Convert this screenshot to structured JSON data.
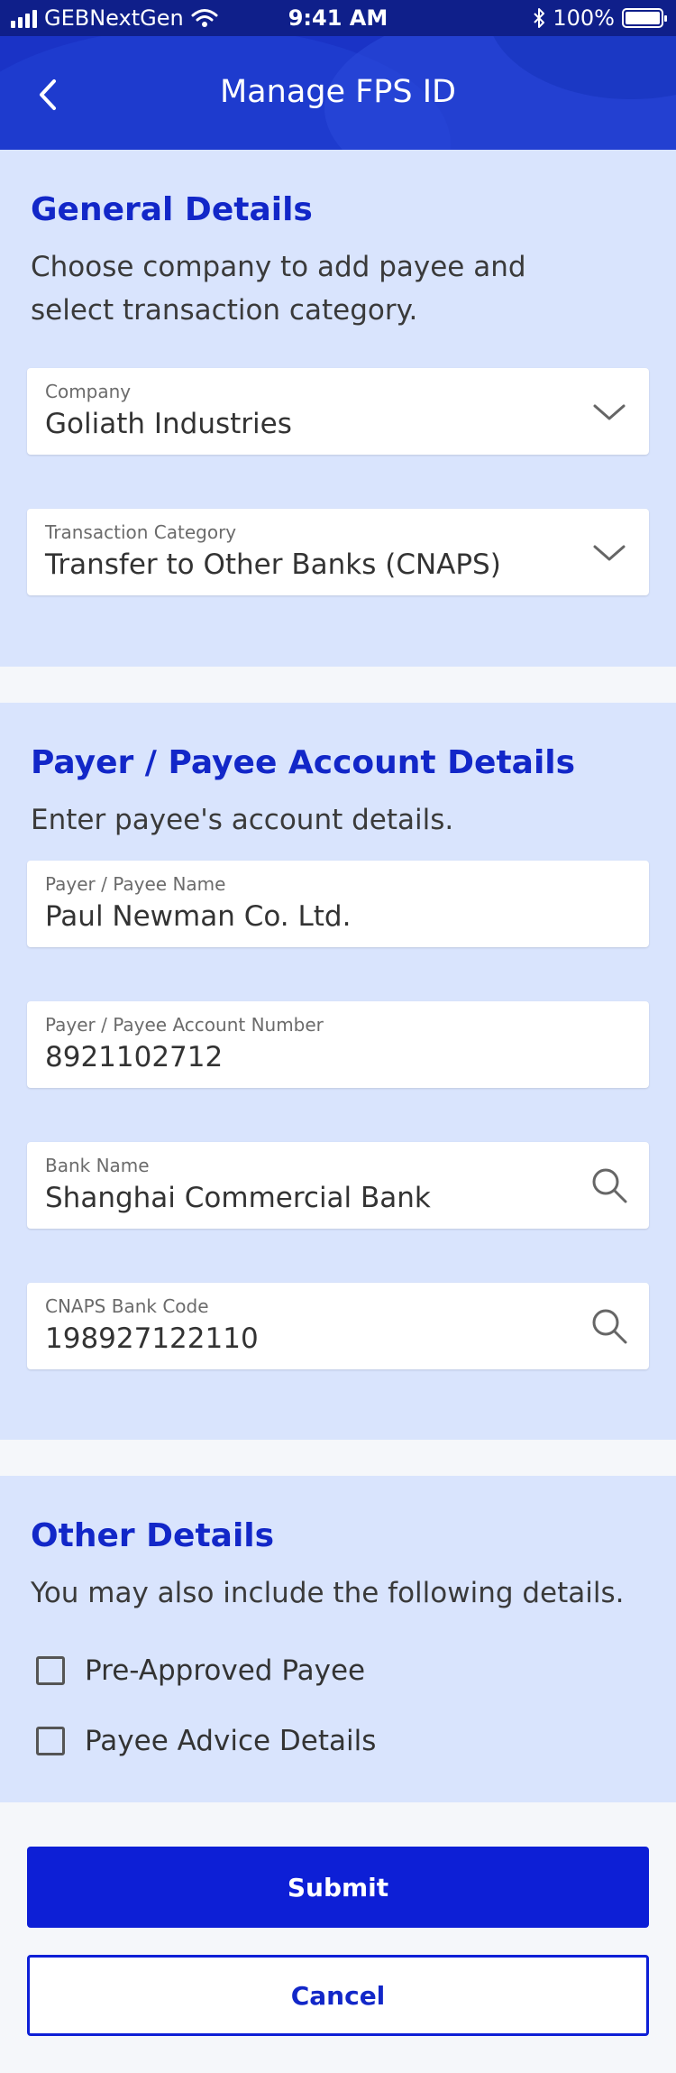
{
  "status_bar": {
    "carrier": "GEBNextGen",
    "time": "9:41 AM",
    "battery": "100%"
  },
  "header": {
    "title": "Manage FPS ID",
    "back_icon": "chevron-left-icon"
  },
  "general": {
    "title": "General Details",
    "description": "Choose company to add payee and select transaction category.",
    "company": {
      "label": "Company",
      "value": "Goliath Industries",
      "icon": "chevron-down-icon"
    },
    "transaction_category": {
      "label": "Transaction Category",
      "value": "Transfer to Other Banks (CNAPS)",
      "icon": "chevron-down-icon"
    }
  },
  "payee": {
    "title": "Payer / Payee Account Details",
    "description": "Enter payee's account details.",
    "name": {
      "label": "Payer / Payee Name",
      "value": "Paul Newman Co. Ltd."
    },
    "account_number": {
      "label": "Payer / Payee Account Number",
      "value": "8921102712"
    },
    "bank_name": {
      "label": "Bank Name",
      "value": "Shanghai Commercial Bank",
      "icon": "search-icon"
    },
    "cnaps_code": {
      "label": "CNAPS Bank Code",
      "value": "198927122110",
      "icon": "search-icon"
    }
  },
  "other": {
    "title": "Other Details",
    "description": "You may also include the following details.",
    "options": [
      {
        "label": "Pre-Approved Payee",
        "checked": false
      },
      {
        "label": "Payee Advice Details",
        "checked": false
      }
    ]
  },
  "actions": {
    "submit_label": "Submit",
    "cancel_label": "Cancel"
  },
  "colors": {
    "primary": "#0d1fd6",
    "section_bg": "#d9e4fd",
    "header_bg": "#1a33c6",
    "title_text": "#1227c8"
  }
}
